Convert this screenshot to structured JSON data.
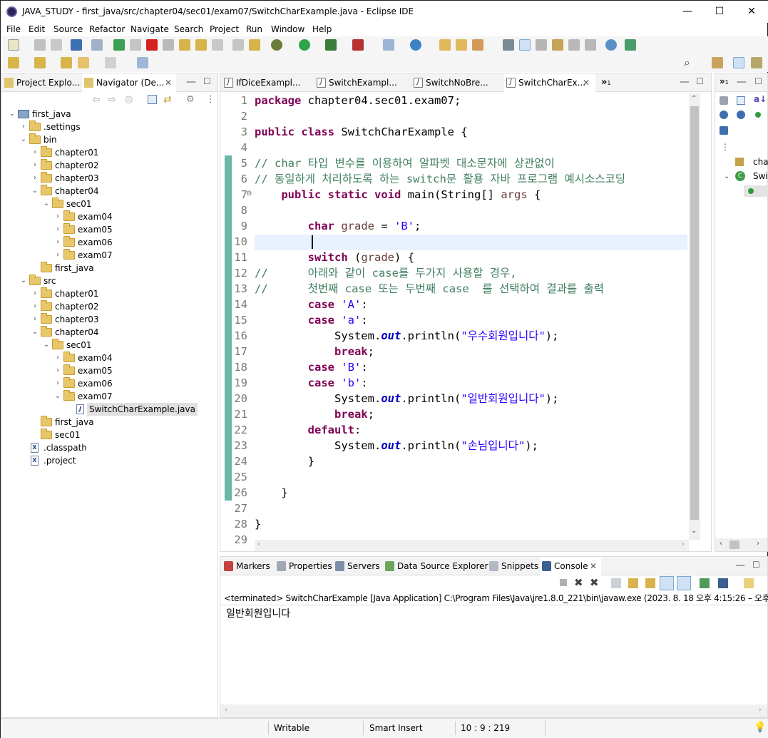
{
  "window": {
    "title": "JAVA_STUDY - first_java/src/chapter04/sec01/exam07/SwitchCharExample.java - Eclipse IDE",
    "minimize_glyph": "—",
    "maximize_glyph": "☐",
    "close_glyph": "✕"
  },
  "menu": [
    "File",
    "Edit",
    "Source",
    "Refactor",
    "Navigate",
    "Search",
    "Project",
    "Run",
    "Window",
    "Help"
  ],
  "left_panel": {
    "tabs": [
      "Project Explo...",
      "Navigator (De..."
    ],
    "tree": [
      {
        "label": "first_java",
        "type": "project",
        "depth": 0,
        "twisty": "open"
      },
      {
        "label": ".settings",
        "type": "folder",
        "depth": 1,
        "twisty": "closed"
      },
      {
        "label": "bin",
        "type": "folder",
        "depth": 1,
        "twisty": "open"
      },
      {
        "label": "chapter01",
        "type": "folder",
        "depth": 2,
        "twisty": "closed"
      },
      {
        "label": "chapter02",
        "type": "folder",
        "depth": 2,
        "twisty": "closed"
      },
      {
        "label": "chapter03",
        "type": "folder",
        "depth": 2,
        "twisty": "closed"
      },
      {
        "label": "chapter04",
        "type": "folder",
        "depth": 2,
        "twisty": "open"
      },
      {
        "label": "sec01",
        "type": "folder",
        "depth": 3,
        "twisty": "open"
      },
      {
        "label": "exam04",
        "type": "folder",
        "depth": 4,
        "twisty": "closed"
      },
      {
        "label": "exam05",
        "type": "folder",
        "depth": 4,
        "twisty": "closed"
      },
      {
        "label": "exam06",
        "type": "folder",
        "depth": 4,
        "twisty": "closed"
      },
      {
        "label": "exam07",
        "type": "folder",
        "depth": 4,
        "twisty": "closed"
      },
      {
        "label": "first_java",
        "type": "folder",
        "depth": 2,
        "twisty": "none"
      },
      {
        "label": "src",
        "type": "folder",
        "depth": 1,
        "twisty": "open"
      },
      {
        "label": "chapter01",
        "type": "folder",
        "depth": 2,
        "twisty": "closed"
      },
      {
        "label": "chapter02",
        "type": "folder",
        "depth": 2,
        "twisty": "closed"
      },
      {
        "label": "chapter03",
        "type": "folder",
        "depth": 2,
        "twisty": "closed"
      },
      {
        "label": "chapter04",
        "type": "folder",
        "depth": 2,
        "twisty": "open"
      },
      {
        "label": "sec01",
        "type": "folder",
        "depth": 3,
        "twisty": "open"
      },
      {
        "label": "exam04",
        "type": "folder",
        "depth": 4,
        "twisty": "closed"
      },
      {
        "label": "exam05",
        "type": "folder",
        "depth": 4,
        "twisty": "closed"
      },
      {
        "label": "exam06",
        "type": "folder",
        "depth": 4,
        "twisty": "closed"
      },
      {
        "label": "exam07",
        "type": "folder",
        "depth": 4,
        "twisty": "open"
      },
      {
        "label": "SwitchCharExample.java",
        "type": "java",
        "depth": 5,
        "twisty": "none",
        "selected": true
      },
      {
        "label": "first_java",
        "type": "folder",
        "depth": 2,
        "twisty": "none"
      },
      {
        "label": "sec01",
        "type": "folder",
        "depth": 2,
        "twisty": "none"
      },
      {
        "label": ".classpath",
        "type": "xml",
        "depth": 1,
        "twisty": "none"
      },
      {
        "label": ".project",
        "type": "xml",
        "depth": 1,
        "twisty": "none"
      }
    ]
  },
  "editor": {
    "tabs": [
      "IfDiceExampl...",
      "SwitchExampl...",
      "SwitchNoBre...",
      "SwitchCharEx..."
    ],
    "overflow_label": "»",
    "overflow_count": "1",
    "active_tab_index": 3,
    "current_line": 10,
    "lines": [
      [
        [
          "kw",
          "package"
        ],
        [
          "",
          "chapter04.sec01.exam07;"
        ]
      ],
      [],
      [
        [
          "kw",
          "public"
        ],
        [
          "",
          ""
        ],
        [
          "kw",
          "class"
        ],
        [
          "",
          "SwitchCharExample {"
        ]
      ],
      [],
      [
        [
          "cm",
          "// char 타입 변수를 이용하여 알파벳 대소문자에 상관없이"
        ]
      ],
      [
        [
          "cm",
          "// 동일하게 처리하도록 하는 switch문 활용 자바 프로그램 예시소스코딩"
        ]
      ],
      [
        [
          "",
          "    "
        ],
        [
          "kw",
          "public"
        ],
        [
          "",
          ""
        ],
        [
          "kw",
          "static"
        ],
        [
          "",
          ""
        ],
        [
          "kw",
          "void"
        ],
        [
          "",
          "main(String[] "
        ],
        [
          "vr",
          "args"
        ],
        [
          "",
          " {"
        ]
      ],
      [],
      [
        [
          "",
          "        "
        ],
        [
          "kw",
          "char"
        ],
        [
          "",
          ""
        ],
        [
          "vr",
          "grade"
        ],
        [
          "",
          " = "
        ],
        [
          "st",
          "'B'"
        ],
        [
          "",
          ";"
        ]
      ],
      [],
      [
        [
          "",
          "        "
        ],
        [
          "kw",
          "switch"
        ],
        [
          "",
          " ("
        ],
        [
          "vr",
          "grade"
        ],
        [
          "",
          ") {"
        ]
      ],
      [
        [
          "cm",
          "//      아래와 같이 case를 두가지 사용할 경우,"
        ]
      ],
      [
        [
          "cm",
          "//      첫번째 case 또는 두번째 case  를 선택하여 결과를 출력"
        ]
      ],
      [
        [
          "",
          "        "
        ],
        [
          "kw",
          "case"
        ],
        [
          "",
          ""
        ],
        [
          "st",
          "'A'"
        ],
        [
          "",
          ":"
        ]
      ],
      [
        [
          "",
          "        "
        ],
        [
          "kw",
          "case"
        ],
        [
          "",
          ""
        ],
        [
          "st",
          "'a'"
        ],
        [
          "",
          ":"
        ]
      ],
      [
        [
          "",
          "            System."
        ],
        [
          "fld",
          "out"
        ],
        [
          "",
          ".println("
        ],
        [
          "st",
          "\"우수회원입니다\""
        ],
        [
          "",
          ");"
        ]
      ],
      [
        [
          "",
          "            "
        ],
        [
          "kw",
          "break"
        ],
        [
          "",
          ";"
        ]
      ],
      [
        [
          "",
          "        "
        ],
        [
          "kw",
          "case"
        ],
        [
          "",
          ""
        ],
        [
          "st",
          "'B'"
        ],
        [
          "",
          ":"
        ]
      ],
      [
        [
          "",
          "        "
        ],
        [
          "kw",
          "case"
        ],
        [
          "",
          ""
        ],
        [
          "st",
          "'b'"
        ],
        [
          "",
          ":"
        ]
      ],
      [
        [
          "",
          "            System."
        ],
        [
          "fld",
          "out"
        ],
        [
          "",
          ".println("
        ],
        [
          "st",
          "\"일반회원입니다\""
        ],
        [
          "",
          ");"
        ]
      ],
      [
        [
          "",
          "            "
        ],
        [
          "kw",
          "break"
        ],
        [
          "",
          ";"
        ]
      ],
      [
        [
          "",
          "        "
        ],
        [
          "kw",
          "default"
        ],
        [
          "",
          ":"
        ]
      ],
      [
        [
          "",
          "            System."
        ],
        [
          "fld",
          "out"
        ],
        [
          "",
          ".println("
        ],
        [
          "st",
          "\"손님입니다\""
        ],
        [
          "",
          ");"
        ]
      ],
      [
        [
          "",
          "        }"
        ]
      ],
      [],
      [
        [
          "",
          "    }"
        ]
      ],
      [],
      [
        [
          "",
          "}"
        ]
      ],
      []
    ]
  },
  "outline": {
    "items": [
      "cha",
      "Swi"
    ]
  },
  "bottom_panel": {
    "tabs": [
      "Markers",
      "Properties",
      "Servers",
      "Data Source Explorer",
      "Snippets",
      "Console"
    ],
    "active_tab": "Console",
    "console_header": "<terminated> SwitchCharExample [Java Application] C:\\Program Files\\Java\\jre1.8.0_221\\bin\\javaw.exe  (2023. 8. 18 오후 4:15:26 – 오후",
    "console_output": "일반회원입니다"
  },
  "status_bar": {
    "writable": "Writable",
    "insert_mode": "Smart Insert",
    "position": "10 : 9 : 219"
  },
  "colors": {
    "keyword": "#7f0055",
    "comment": "#3f7f5f",
    "string": "#2a00ff",
    "static_field": "#0000c0",
    "current_line": "#e8f2fe",
    "change_bar": "#69b7a6",
    "selection": "#e0e0e0"
  }
}
